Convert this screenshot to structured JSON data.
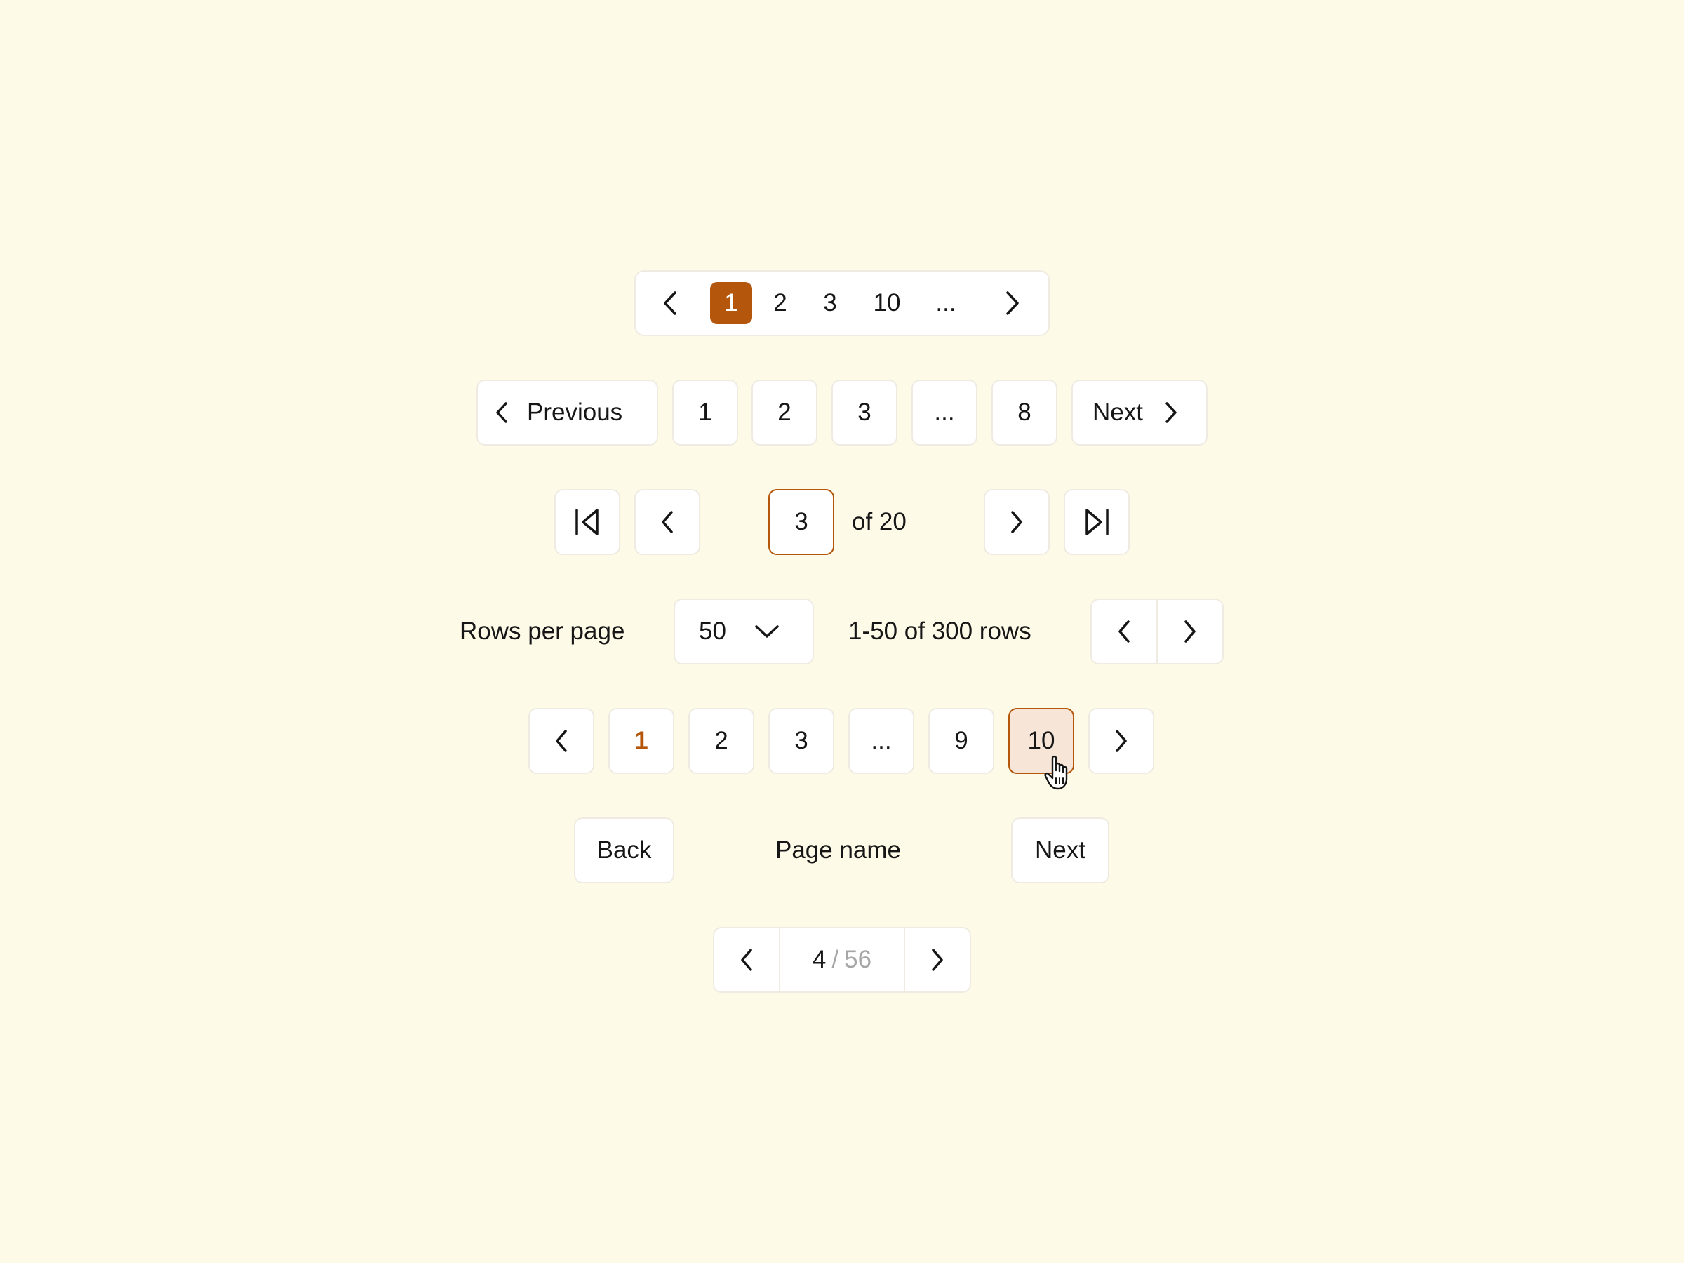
{
  "colors": {
    "background": "#FEFAE8",
    "accent": "#B4560B",
    "accent_soft": "#F7E5D7",
    "border": "#EFEBE2",
    "muted_text": "#A6A6A6"
  },
  "compact_pager": {
    "pages": [
      "1",
      "2",
      "3",
      "10",
      "..."
    ],
    "current": "1",
    "prev_icon": "chevron-left-icon",
    "next_icon": "chevron-right-icon"
  },
  "labeled_pager": {
    "previous_label": "Previous",
    "next_label": "Next",
    "pages": [
      "1",
      "2",
      "3",
      "...",
      "8"
    ]
  },
  "jump_pager": {
    "current_page_value": "3",
    "of_text": "of 20",
    "first_icon": "first-page-icon",
    "last_icon": "last-page-icon"
  },
  "rows_pager": {
    "rows_per_page_label": "Rows per page",
    "rows_per_page_value": "50",
    "range_text": "1-50 of 300 rows"
  },
  "numbered_pager": {
    "pages": [
      "1",
      "2",
      "3",
      "...",
      "9",
      "10"
    ],
    "current": "1",
    "hovered": "10"
  },
  "back_next": {
    "back_label": "Back",
    "page_name": "Page name",
    "next_label": "Next"
  },
  "counter_pager": {
    "current": "4",
    "separator": "/",
    "total": "56"
  }
}
